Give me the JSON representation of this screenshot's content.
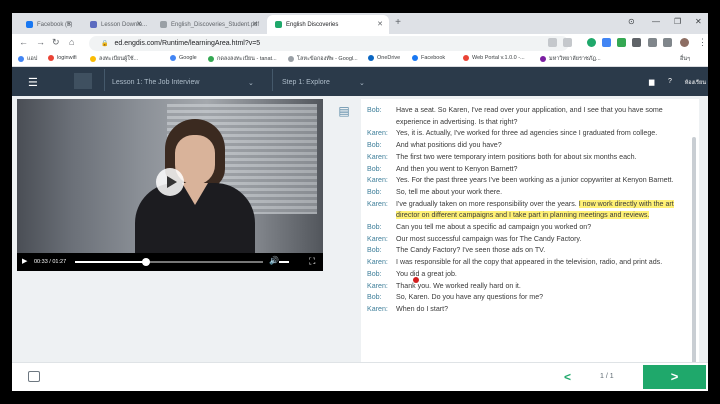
{
  "browser": {
    "tabs": [
      {
        "title": "Facebook (5)",
        "favicon_color": "#1877f2"
      },
      {
        "title": "Lesson Downlo...",
        "favicon_color": "#5c6bc0"
      },
      {
        "title": "English_Discoveries_Student.pdf",
        "favicon_color": "#9aa0a6"
      },
      {
        "title": "English Discoveries",
        "favicon_color": "#1fa86b"
      }
    ],
    "new_tab_label": "+",
    "url": "ed.engdis.com/Runtime/learningArea.html?v=5",
    "bookmarks": [
      {
        "label": "แอป",
        "color": "#4285f4"
      },
      {
        "label": "loginwifi",
        "color": "#ea4335"
      },
      {
        "label": "ลงทะเบียนผู้ใช้...",
        "color": "#fbbc04"
      },
      {
        "label": "Google",
        "color": "#4285f4"
      },
      {
        "label": "กดลงลงทะเบียน - tanat...",
        "color": "#34a853"
      },
      {
        "label": "โลหะข้อกองทัพ - Googl...",
        "color": "#9aa0a6"
      },
      {
        "label": "OneDrive",
        "color": "#0a66c2"
      },
      {
        "label": "Facebook",
        "color": "#1877f2"
      },
      {
        "label": "Web Portal v.1.0.0 -...",
        "color": "#ea4335"
      },
      {
        "label": "มหาวิทยาลัยราชภัฏ...",
        "color": "#7b1fa2"
      }
    ],
    "bookmarks_overflow": "อื่นๆ"
  },
  "app": {
    "lesson": "Lesson 1: The Job Interview",
    "step": "Step 1: Explore",
    "help": "?",
    "more": "ห้องเรียน"
  },
  "video": {
    "time_current": "00:33",
    "time_total": "01:27",
    "progress": 0.38
  },
  "transcript": [
    {
      "speaker": "Bob:",
      "text": "Have a seat. So Karen, I've read over your application, and I see that you have some experience in advertising. Is that right?"
    },
    {
      "speaker": "Karen:",
      "text": "Yes, it is. Actually, I've worked for three ad agencies since I graduated from college."
    },
    {
      "speaker": "Bob:",
      "text": "And what positions did you have?"
    },
    {
      "speaker": "Karen:",
      "text": "The first two were temporary intern positions both for about six months each."
    },
    {
      "speaker": "Bob:",
      "text": "And then you went to Kenyon Barnett?"
    },
    {
      "speaker": "Karen:",
      "text": "Yes. For the past three years I've been working as a junior copywriter at Kenyon Barnett."
    },
    {
      "speaker": "Bob:",
      "text": "So, tell me about your work there."
    },
    {
      "speaker": "Karen:",
      "text": "I've gradually taken on more responsibility over the years. ",
      "highlight": "I now work directly with the art director on different campaigns and I take part in planning meetings and reviews."
    },
    {
      "speaker": "Bob:",
      "text": "Can you tell me about a specific ad campaign you worked on?"
    },
    {
      "speaker": "Karen:",
      "text": "Our most successful campaign was for The Candy Factory."
    },
    {
      "speaker": "Bob:",
      "text": "The Candy Factory? I've seen those ads on TV."
    },
    {
      "speaker": "Karen:",
      "text": "I was responsible for all the copy that appeared in the television, radio, and print ads."
    },
    {
      "speaker": "Bob:",
      "text": "You did a great job."
    },
    {
      "speaker": "Karen:",
      "text": "Thank you. We worked really hard on it."
    },
    {
      "speaker": "Bob:",
      "text": "So, Karen. Do you have any questions for me?"
    },
    {
      "speaker": "Karen:",
      "text": "When do I start?"
    }
  ],
  "footer": {
    "prev": "<",
    "pager": "1 / 1",
    "next": ">"
  }
}
